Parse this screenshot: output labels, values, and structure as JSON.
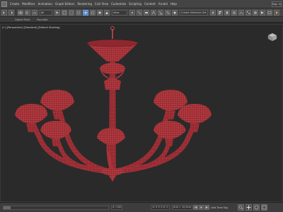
{
  "app": {
    "menu": [
      "Create",
      "Modifiers",
      "Animation",
      "Graph Editors",
      "Rendering",
      "Civil View",
      "Customize",
      "Scripting",
      "Content",
      "Arnold",
      "Help"
    ],
    "signin_label": "Sign In"
  },
  "toolbar": {
    "selection_filter": "All",
    "view_select": "View",
    "named_selection": "Create Selection Set"
  },
  "subtabs": [
    "Object Paint",
    "Populate"
  ],
  "viewport": {
    "label": "[+] [Perspective] [Standard] [Default Shading]"
  },
  "status": {
    "frame_counter": "0 / 100",
    "coords": "X: 0   Y: 0   Z: 0",
    "grid": "Grid = 10,0cm",
    "add_time_tag": "Add Time Tag"
  },
  "colors": {
    "model": "#b33a40",
    "wire": "#5a1418",
    "accent": "#4a7dbe",
    "viewport_bg": "#2a2a2a"
  }
}
